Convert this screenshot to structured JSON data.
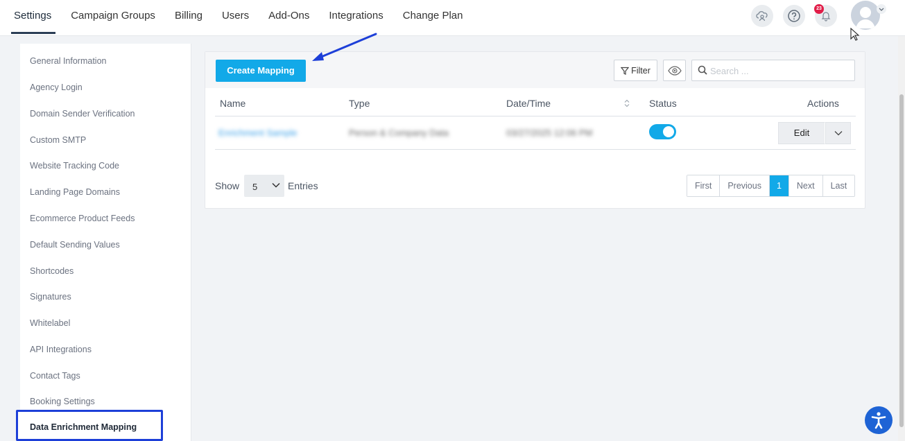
{
  "nav": {
    "tabs": [
      "Settings",
      "Campaign Groups",
      "Billing",
      "Users",
      "Add-Ons",
      "Integrations",
      "Change Plan"
    ],
    "notification_count": "23",
    "icons": [
      "cloud-user-icon",
      "help-icon",
      "bell-icon",
      "avatar",
      "chevron-down-icon"
    ]
  },
  "sidebar": {
    "items": [
      "General Information",
      "Agency Login",
      "Domain Sender Verification",
      "Custom SMTP",
      "Website Tracking Code",
      "Landing Page Domains",
      "Ecommerce Product Feeds",
      "Default Sending Values",
      "Shortcodes",
      "Signatures",
      "Whitelabel",
      "API Integrations",
      "Contact Tags",
      "Booking Settings"
    ],
    "active": "Data Enrichment Mapping"
  },
  "toolbar": {
    "create_label": "Create Mapping",
    "filter_label": "Filter",
    "search_placeholder": "Search ..."
  },
  "table": {
    "headers": {
      "name": "Name",
      "type": "Type",
      "datetime": "Date/Time",
      "status": "Status",
      "actions": "Actions"
    },
    "rows": [
      {
        "name": "Enrichment Sample",
        "type": "Person & Company Data",
        "datetime": "03/27/2025 12:06 PM",
        "status_on": true,
        "edit_label": "Edit"
      }
    ]
  },
  "footer": {
    "show_label": "Show",
    "entries_value": "5",
    "entries_label": "Entries",
    "pager": [
      "First",
      "Previous",
      "1",
      "Next",
      "Last"
    ],
    "current_page": "1"
  },
  "colors": {
    "accent": "#12a9e8",
    "annotation": "#1d3fd8",
    "accessibility": "#1e63d5"
  }
}
